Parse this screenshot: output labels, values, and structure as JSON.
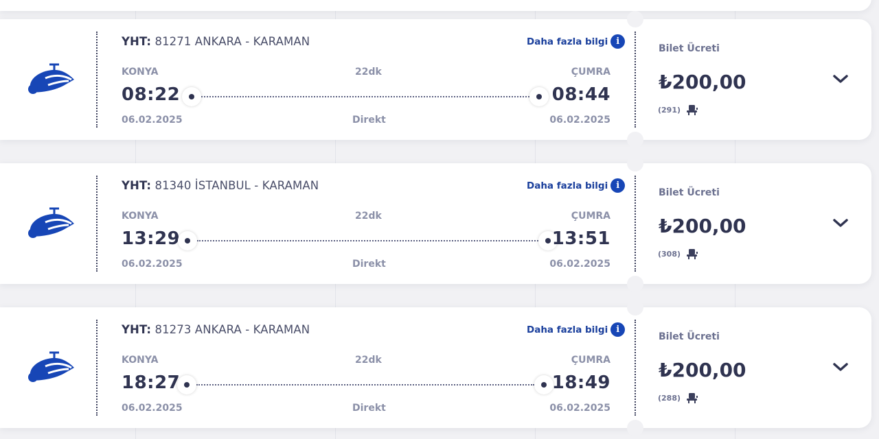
{
  "info_link_label": "Daha fazla bilgi",
  "info_icon_glyph": "i",
  "fare_label": "Bilet Ücreti",
  "trips": [
    {
      "type": "YHT:",
      "route": "81271 ANKARA - KARAMAN",
      "from_station": "KONYA",
      "to_station": "ÇUMRA",
      "duration": "22dk",
      "departure_time": "08:22",
      "arrival_time": "08:44",
      "departure_date": "06.02.2025",
      "arrival_date": "06.02.2025",
      "connection": "Direkt",
      "price": "₺200,00",
      "seats_available": "(291)"
    },
    {
      "type": "YHT:",
      "route": "81340 İSTANBUL - KARAMAN",
      "from_station": "KONYA",
      "to_station": "ÇUMRA",
      "duration": "22dk",
      "departure_time": "13:29",
      "arrival_time": "13:51",
      "departure_date": "06.02.2025",
      "arrival_date": "06.02.2025",
      "connection": "Direkt",
      "price": "₺200,00",
      "seats_available": "(308)"
    },
    {
      "type": "YHT:",
      "route": "81273 ANKARA - KARAMAN",
      "from_station": "KONYA",
      "to_station": "ÇUMRA",
      "duration": "22dk",
      "departure_time": "18:27",
      "arrival_time": "18:49",
      "departure_date": "06.02.2025",
      "arrival_date": "06.02.2025",
      "connection": "Direkt",
      "price": "₺200,00",
      "seats_available": "(288)"
    }
  ],
  "colors": {
    "accent_blue": "#1746b6",
    "text_dark": "#2f3350",
    "text_muted": "#8b90a8",
    "background": "#f1f1f4"
  },
  "icons": {
    "train": "high-speed-train-icon",
    "info": "info-icon",
    "seat": "seat-icon",
    "expand": "chevron-down-icon"
  }
}
